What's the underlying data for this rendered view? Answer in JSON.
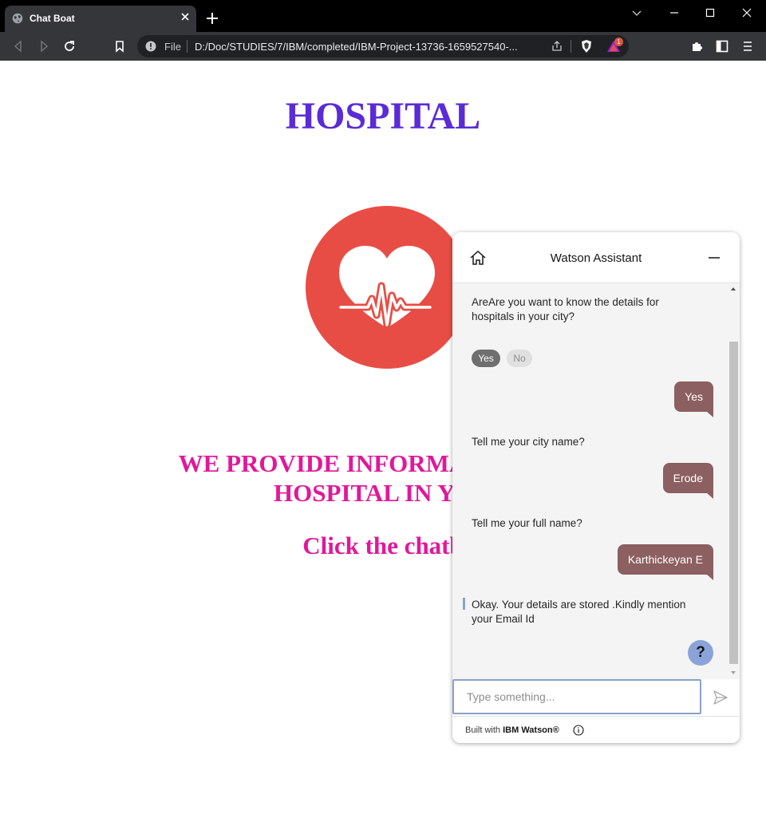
{
  "browser": {
    "tab_title": "Chat Boat",
    "address_scheme": "File",
    "address_url": "D:/Doc/STUDIES/7/IBM/completed/IBM-Project-13736-1659527540-...",
    "rewards_badge": "1"
  },
  "page": {
    "title": "HOSPITAL",
    "logo_icon": "heart-pulse-icon",
    "info_line1": "WE PROVIDE INFORMATION ON I",
    "info_line2": "HOSPITAL IN YOU",
    "cta": "Click the chatb"
  },
  "chat": {
    "title": "Watson Assistant",
    "messages": [
      {
        "from": "bot",
        "text": "AreAre you want to know the details for hospitals in your city?"
      },
      {
        "from": "user",
        "text": "Yes"
      },
      {
        "from": "bot",
        "text": "Tell me your city name?"
      },
      {
        "from": "user",
        "text": "Erode"
      },
      {
        "from": "bot",
        "text": "Tell me your full name?"
      },
      {
        "from": "user",
        "text": "Karthickeyan E"
      },
      {
        "from": "bot",
        "text": "Okay. Your details are stored .Kindly mention your Email Id"
      }
    ],
    "options": [
      "Yes",
      "No"
    ],
    "input_placeholder": "Type something...",
    "help_label": "?",
    "footer_prefix": "Built with",
    "footer_brand": "IBM Watson®"
  },
  "colors": {
    "title": "#5a2bd6",
    "info_text": "#e0189b",
    "logo_bg": "#e84d45",
    "user_bubble": "#8c5f60"
  }
}
